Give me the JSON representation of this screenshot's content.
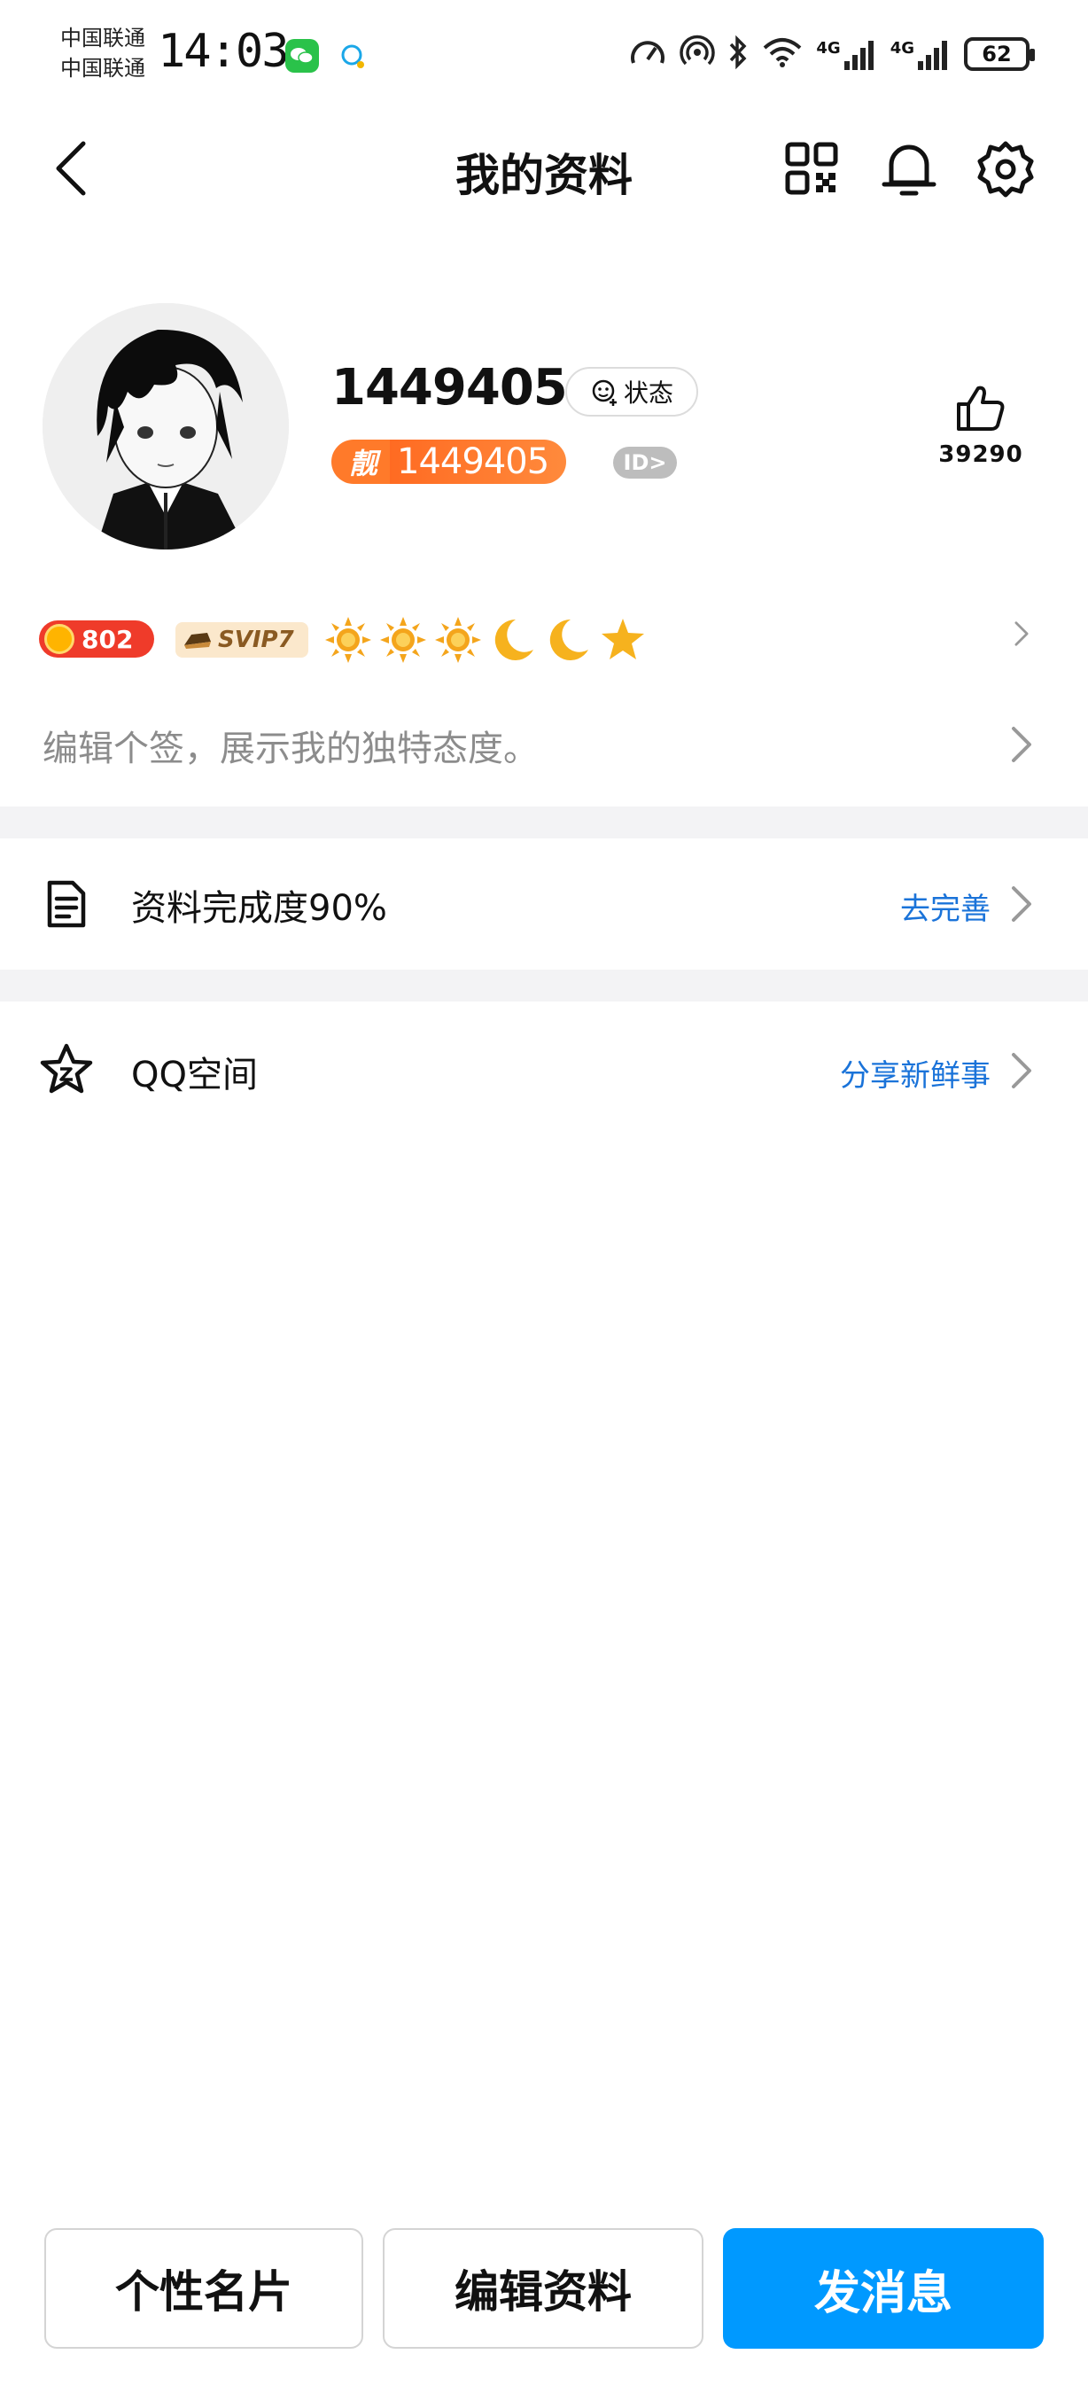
{
  "status_bar": {
    "carrier_1": "中国联通",
    "carrier_2": "中国联通",
    "time": "14:03",
    "network_1": "4G",
    "network_2": "4G",
    "battery": "62"
  },
  "header": {
    "title": "我的资料"
  },
  "profile": {
    "nickname": "1449405",
    "status_label": "状态",
    "qq_tag": "靓",
    "qq_number": "1449405",
    "id_badge": "ID>",
    "likes_count": "39290"
  },
  "badges": {
    "coin_value": "802",
    "svip_label": "SVIP7",
    "level_icons": [
      "sun-icon",
      "sun-icon",
      "sun-icon",
      "moon-icon",
      "moon-icon",
      "star-icon"
    ]
  },
  "signature": {
    "placeholder": "编辑个签，展示我的独特态度。"
  },
  "profile_completion": {
    "label": "资料完成度90%",
    "action": "去完善",
    "percent": 90
  },
  "qzone": {
    "label": "QQ空间",
    "action": "分享新鲜事"
  },
  "bottom_bar": {
    "card_button": "个性名片",
    "edit_button": "编辑资料",
    "message_button": "发消息"
  },
  "colors": {
    "accent_blue": "#0099ff",
    "link_blue": "#1a73d9",
    "qid_orange": "#ff7a2a"
  }
}
